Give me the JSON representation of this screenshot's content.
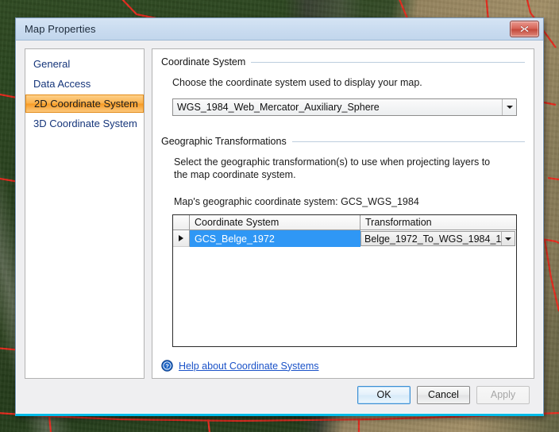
{
  "background": {
    "description": "aerial-imagery-with-red-parcel-boundaries"
  },
  "dialog": {
    "title": "Map Properties",
    "close_label": "Close",
    "sidebar": {
      "items": [
        {
          "label": "General",
          "selected": false
        },
        {
          "label": "Data Access",
          "selected": false
        },
        {
          "label": "2D Coordinate System",
          "selected": true
        },
        {
          "label": "3D Coordinate System",
          "selected": false
        }
      ]
    },
    "coordinate_system_group": {
      "legend": "Coordinate System",
      "description": "Choose the coordinate system used to display your map.",
      "combo_value": "WGS_1984_Web_Mercator_Auxiliary_Sphere"
    },
    "transformations_group": {
      "legend": "Geographic Transformations",
      "description": "Select the geographic transformation(s) to use when projecting layers to the map coordinate system.",
      "map_gcs_text": "Map's geographic coordinate system: GCS_WGS_1984",
      "columns": [
        "Coordinate System",
        "Transformation"
      ],
      "rows": [
        {
          "selector": "▶",
          "coordinate_system": "GCS_Belge_1972",
          "transformation": "Belge_1972_To_WGS_1984_1"
        }
      ]
    },
    "help": {
      "icon": "help-circle-icon",
      "link_label": "Help about Coordinate Systems"
    },
    "footer": {
      "ok_label": "OK",
      "cancel_label": "Cancel",
      "apply_label": "Apply",
      "apply_disabled": true
    },
    "colors": {
      "selection_blue": "#2f97f5",
      "sidebar_selected_orange": "#f79b24",
      "link_blue": "#1a52c8",
      "accent_bottom_border": "#00bce8"
    }
  }
}
